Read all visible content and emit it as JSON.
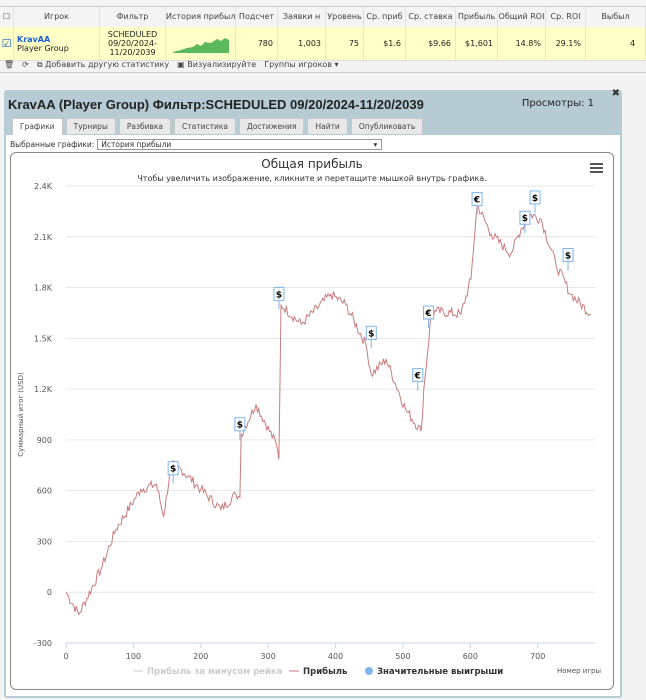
{
  "grid": {
    "headers": [
      "Игрок",
      "Фильтр",
      "История прибыл",
      "Подсчет",
      "Заявки н",
      "Уровень",
      "Ср. приб",
      "Ср. ставка",
      "Прибыль",
      "Общий ROI",
      "Ср. ROI",
      "Выбыл"
    ],
    "row": {
      "player": "KravAA",
      "group": "Player Group",
      "filter": "SCHEDULED 09/20/2024- 11/20/2039",
      "count": "780",
      "entries": "1,003",
      "level": "75",
      "avg_profit": "$1.6",
      "avg_stake": "$9.66",
      "profit": "$1,601",
      "total_roi": "14.8%",
      "avg_roi": "29.1%",
      "out": "4"
    }
  },
  "toolbar": {
    "add_stat": "Добавить другую статистику",
    "visualize": "Визуализируйте",
    "groups": "Группы игроков"
  },
  "panel": {
    "title": "KravAA (Player Group) Фильтр:SCHEDULED 09/20/2024-11/20/2039",
    "views": "Просмотры: 1",
    "tabs": [
      "Графики",
      "Турниры",
      "Разбивка",
      "Статистика",
      "Достижения",
      "Найти",
      "Опубликовать"
    ],
    "selected_label": "Выбранные графики:",
    "selected_value": "История прибыли"
  },
  "chart_data": {
    "type": "line",
    "title": "Общая прибыль",
    "subtitle": "Чтобы увеличить изображение, кликните и перетащите мышкой внутрь графика.",
    "xlabel": "Номер игры",
    "ylabel": "Суммарный итог (USD)",
    "xlim": [
      0,
      780
    ],
    "ylim": [
      -300,
      2400
    ],
    "xticks": [
      0,
      100,
      200,
      300,
      400,
      500,
      600,
      700
    ],
    "yticks": [
      -300,
      0,
      300,
      600,
      900,
      1200,
      1500,
      1800,
      2100,
      2400
    ],
    "ytick_labels": [
      "-300",
      "0",
      "300",
      "600",
      "900",
      "1.2K",
      "1.5K",
      "1.8K",
      "2.1K",
      "2.4K"
    ],
    "legend": [
      "Прибыль за минусом рейка",
      "Прибыль",
      "Значительные выигрыши"
    ],
    "series": [
      {
        "name": "Прибыль",
        "color": "#c97b7b",
        "x": [
          0,
          19,
          52,
          74,
          111,
          134,
          145,
          156,
          171,
          200,
          230,
          252,
          258,
          260,
          282,
          312,
          316,
          319,
          349,
          393,
          415,
          445,
          453,
          475,
          504,
          527,
          531,
          542,
          549,
          586,
          601,
          610,
          631,
          660,
          675,
          690,
          705,
          727,
          749,
          779
        ],
        "y": [
          0,
          -130,
          136,
          372,
          608,
          638,
          449,
          756,
          726,
          608,
          490,
          579,
          560,
          933,
          1110,
          874,
          785,
          1700,
          1583,
          1760,
          1700,
          1465,
          1287,
          1376,
          1080,
          951,
          1199,
          1642,
          1660,
          1642,
          1850,
          2290,
          2115,
          2000,
          2143,
          2233,
          2203,
          1937,
          1760,
          1642
        ]
      }
    ],
    "big_wins": [
      {
        "x": 159,
        "y": 700,
        "sym": "$"
      },
      {
        "x": 258,
        "y": 960,
        "sym": "$"
      },
      {
        "x": 316,
        "y": 1730,
        "sym": "$"
      },
      {
        "x": 453,
        "y": 1500,
        "sym": "$"
      },
      {
        "x": 522,
        "y": 1250,
        "sym": "€"
      },
      {
        "x": 538,
        "y": 1620,
        "sym": "€"
      },
      {
        "x": 610,
        "y": 2290,
        "sym": "€"
      },
      {
        "x": 681,
        "y": 2180,
        "sym": "$"
      },
      {
        "x": 696,
        "y": 2300,
        "sym": "$"
      },
      {
        "x": 745,
        "y": 1960,
        "sym": "$"
      }
    ]
  }
}
